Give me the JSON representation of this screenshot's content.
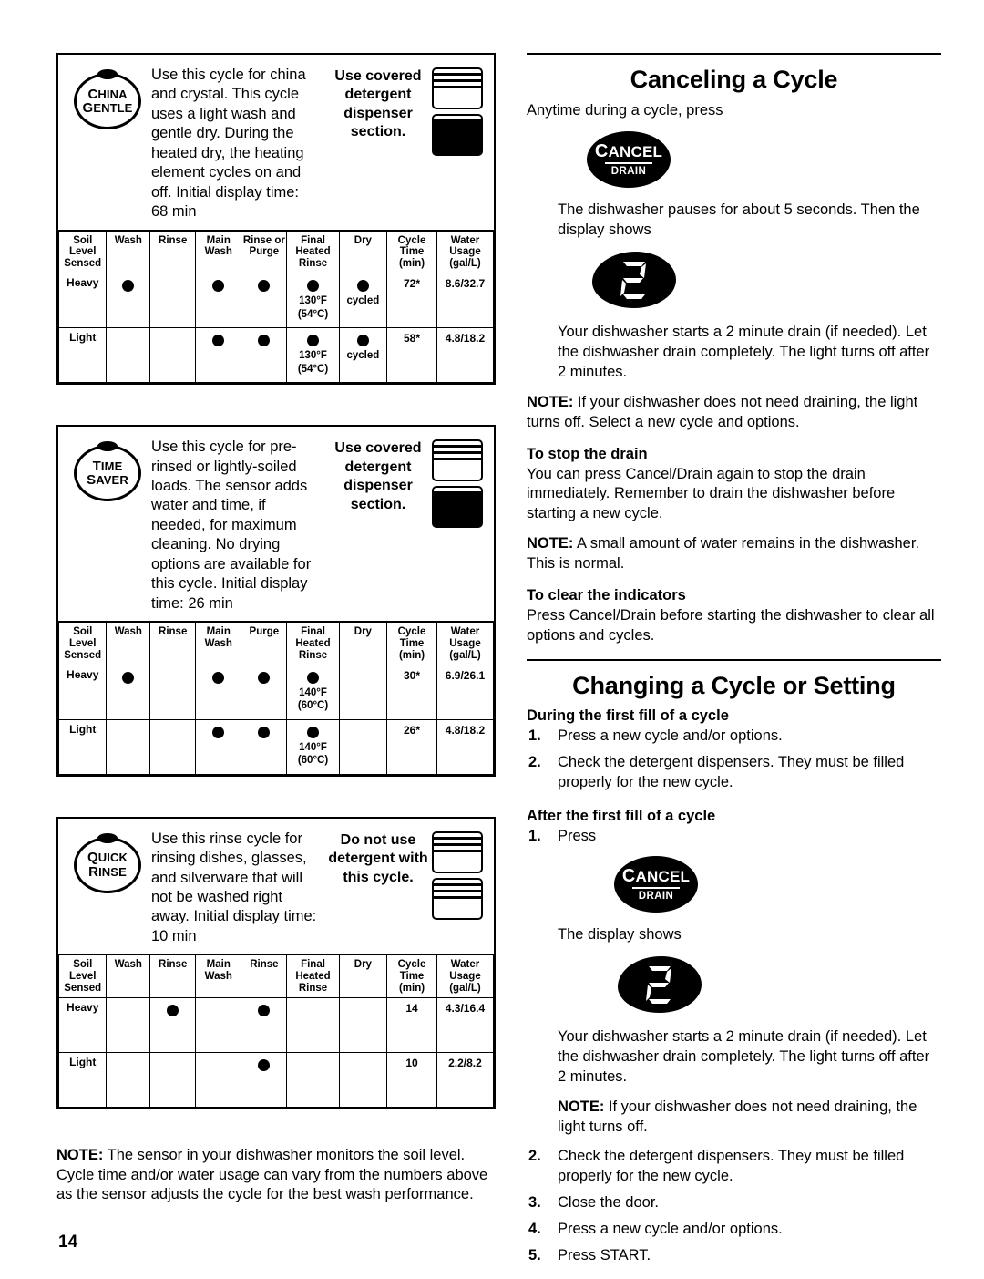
{
  "page": {
    "number": "14"
  },
  "left_column": {
    "cycles": [
      {
        "badge": {
          "name": "china-gentle",
          "line1": "China",
          "line2": "Gentle"
        },
        "description": "Use this cycle for china and crystal. This cycle uses a light wash and gentle dry. During the heated dry, the heating element cycles on and off. Initial display time: 68 min",
        "detergent_note": "Use covered detergent dispenser section.",
        "dispenser_icon": {
          "top": "open",
          "bottom": "covered"
        },
        "table": {
          "headers": [
            "Soil Level Sensed",
            "Wash",
            "Rinse",
            "Main Wash",
            "Rinse or Purge",
            "Final Heated Rinse",
            "Dry",
            "Cycle Time (min)",
            "Water Usage (gal/L)"
          ],
          "rows": [
            {
              "soil": "Heavy",
              "wash": "dot",
              "rinse": "",
              "main_wash": "dot",
              "rinse_purge": "dot",
              "final_rinse": "dot",
              "final_rinse_sub": "130°F (54°C)",
              "dry": "dot",
              "dry_sub": "cycled",
              "cycle_time": "72*",
              "water_usage": "8.6/32.7"
            },
            {
              "soil": "Light",
              "wash": "",
              "rinse": "",
              "main_wash": "dot",
              "rinse_purge": "dot",
              "final_rinse": "dot",
              "final_rinse_sub": "130°F (54°C)",
              "dry": "dot",
              "dry_sub": "cycled",
              "cycle_time": "58*",
              "water_usage": "4.8/18.2"
            }
          ]
        }
      },
      {
        "badge": {
          "name": "time-saver",
          "line1": "Time",
          "line2": "Saver"
        },
        "description": "Use this cycle for pre-rinsed or lightly-soiled loads. The sensor adds water and time, if needed, for maximum cleaning. No drying options are available for this cycle. Initial display time: 26 min",
        "detergent_note": "Use covered detergent dispenser section.",
        "dispenser_icon": {
          "top": "open",
          "bottom": "covered"
        },
        "table": {
          "headers": [
            "Soil Level Sensed",
            "Wash",
            "Rinse",
            "Main Wash",
            "Purge",
            "Final Heated Rinse",
            "Dry",
            "Cycle Time (min)",
            "Water Usage (gal/L)"
          ],
          "rows": [
            {
              "soil": "Heavy",
              "wash": "dot",
              "rinse": "",
              "main_wash": "dot",
              "rinse_purge": "dot",
              "final_rinse": "dot",
              "final_rinse_sub": "140°F (60°C)",
              "dry": "",
              "dry_sub": "",
              "cycle_time": "30*",
              "water_usage": "6.9/26.1"
            },
            {
              "soil": "Light",
              "wash": "",
              "rinse": "",
              "main_wash": "dot",
              "rinse_purge": "dot",
              "final_rinse": "dot",
              "final_rinse_sub": "140°F (60°C)",
              "dry": "",
              "dry_sub": "",
              "cycle_time": "26*",
              "water_usage": "4.8/18.2"
            }
          ]
        }
      },
      {
        "badge": {
          "name": "quick-rinse",
          "line1": "Quick",
          "line2": "Rinse"
        },
        "description": "Use this rinse cycle for rinsing dishes, glasses, and silverware that will not be washed right away. Initial display time: 10 min",
        "detergent_note": "Do not use detergent with this cycle.",
        "dispenser_icon": {
          "top": "open",
          "bottom": "open"
        },
        "table": {
          "headers": [
            "Soil Level Sensed",
            "Wash",
            "Rinse",
            "Main Wash",
            "Rinse",
            "Final Heated Rinse",
            "Dry",
            "Cycle Time (min)",
            "Water Usage (gal/L)"
          ],
          "rows": [
            {
              "soil": "Heavy",
              "wash": "",
              "rinse": "dot",
              "main_wash": "",
              "rinse_purge": "dot",
              "final_rinse": "",
              "final_rinse_sub": "",
              "dry": "",
              "dry_sub": "",
              "cycle_time": "14",
              "water_usage": "4.3/16.4"
            },
            {
              "soil": "Light",
              "wash": "",
              "rinse": "",
              "main_wash": "",
              "rinse_purge": "dot",
              "final_rinse": "",
              "final_rinse_sub": "",
              "dry": "",
              "dry_sub": "",
              "cycle_time": "10",
              "water_usage": "2.2/8.2"
            }
          ]
        }
      }
    ],
    "footer_note": {
      "label": "NOTE:",
      "text": " The sensor in your dishwasher monitors the soil level. Cycle time and/or water usage can vary from the numbers above as the sensor adjusts the cycle for the best wash performance."
    }
  },
  "right_column": {
    "section1": {
      "title": "Canceling a Cycle",
      "intro": "Anytime during a cycle, press",
      "cancel_button": {
        "line1": "Cancel",
        "line2": "DRAIN"
      },
      "after_press": "The dishwasher pauses for about 5 seconds. Then the display shows",
      "display_value": "2",
      "drain_text": "Your dishwasher starts a 2 minute drain (if needed). Let the dishwasher drain completely. The light turns off after 2 minutes.",
      "note1_label": "NOTE:",
      "note1_text": " If your dishwasher does not need draining, the light turns off. Select a new cycle and options.",
      "stop_drain_heading": "To stop the drain",
      "stop_drain_text": "You can press Cancel/Drain again to stop the drain immediately. Remember to drain the dishwasher before starting a new cycle.",
      "note2_label": "NOTE:",
      "note2_text": " A small amount of water remains in the dishwasher. This is normal.",
      "clear_heading": "To clear the indicators",
      "clear_text": "Press Cancel/Drain before starting the dishwasher to clear all options and cycles."
    },
    "section2": {
      "title": "Changing a Cycle or Setting",
      "during_heading": "During the first fill of a cycle",
      "during_steps": [
        {
          "num": "1.",
          "text": "Press a new cycle and/or options."
        },
        {
          "num": "2.",
          "text": "Check the detergent dispensers. They must be filled properly for the new cycle."
        }
      ],
      "after_heading": "After the first fill of a cycle",
      "step1_num": "1.",
      "step1_text": "Press",
      "cancel_button": {
        "line1": "Cancel",
        "line2": "DRAIN"
      },
      "display_shows": "The display shows",
      "display_value": "2",
      "drain_text": "Your dishwasher starts a 2 minute drain (if needed). Let the dishwasher drain completely. The light turns off after 2 minutes.",
      "note_label": "NOTE:",
      "note_text": " If your dishwasher does not need draining, the light turns off.",
      "after_steps": [
        {
          "num": "2.",
          "text": "Check the detergent dispensers. They must be filled properly for the new cycle."
        },
        {
          "num": "3.",
          "text": "Close the door."
        },
        {
          "num": "4.",
          "text": "Press a new cycle and/or options."
        },
        {
          "num": "5.",
          "text": "Press START."
        }
      ]
    }
  }
}
